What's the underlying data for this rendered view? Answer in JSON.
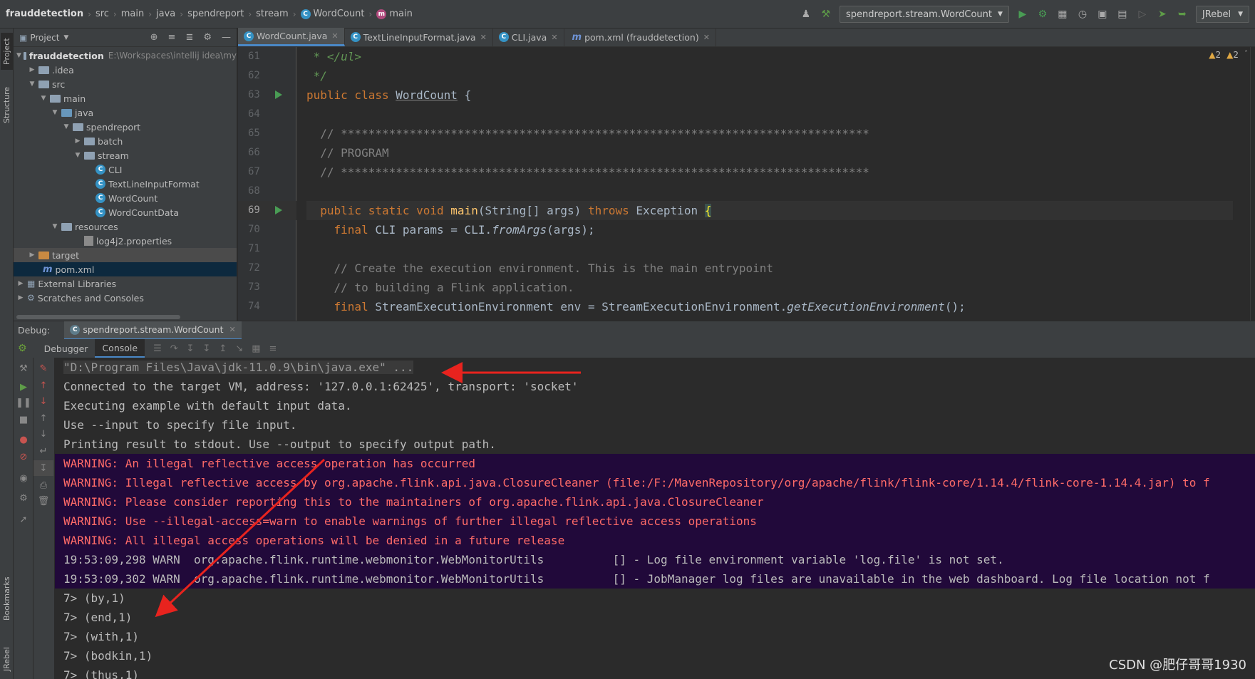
{
  "breadcrumbs": [
    "frauddetection",
    "src",
    "main",
    "java",
    "spendreport",
    "stream",
    "WordCount",
    "main"
  ],
  "toolbar": {
    "run_config": "spendreport.stream.WordCount",
    "jrebel": "JRebel"
  },
  "left_stripe": {
    "project": "Project",
    "structure": "Structure",
    "bookmarks": "Bookmarks",
    "jrebel": "JRebel"
  },
  "project_panel": {
    "title": "Project",
    "root_name": "frauddetection",
    "root_path": "E:\\Workspaces\\intellij idea\\my",
    "items": [
      {
        "label": ".idea"
      },
      {
        "label": "src"
      },
      {
        "label": "main"
      },
      {
        "label": "java"
      },
      {
        "label": "spendreport"
      },
      {
        "label": "batch"
      },
      {
        "label": "stream"
      },
      {
        "label": "CLI"
      },
      {
        "label": "TextLineInputFormat"
      },
      {
        "label": "WordCount"
      },
      {
        "label": "WordCountData"
      },
      {
        "label": "resources"
      },
      {
        "label": "log4j2.properties"
      },
      {
        "label": "target"
      },
      {
        "label": "pom.xml"
      },
      {
        "label": "External Libraries"
      },
      {
        "label": "Scratches and Consoles"
      }
    ]
  },
  "editor_tabs": [
    {
      "label": "WordCount.java"
    },
    {
      "label": "TextLineInputFormat.java"
    },
    {
      "label": "CLI.java"
    },
    {
      "label": "pom.xml (frauddetection)"
    }
  ],
  "inspections": {
    "warn1": "2",
    "warn2": "2"
  },
  "line_numbers": [
    "61",
    "62",
    "63",
    "64",
    "65",
    "66",
    "67",
    "68",
    "69",
    "70",
    "71",
    "72",
    "73",
    "74"
  ],
  "code": {
    "l61": " * </ul>",
    "l62": " */",
    "l63_kw": "public class ",
    "l63_name": "WordCount",
    "l63_rest": " {",
    "l65": "  // *****************************************************************************",
    "l66": "  // PROGRAM",
    "l67": "  // *****************************************************************************",
    "l69_kw": "  public static void ",
    "l69_fn": "main",
    "l69_args": "(String[] args) ",
    "l69_throws": "throws",
    "l69_exc": " Exception ",
    "l69_brace": "{",
    "l70_kw": "    final ",
    "l70_rest": "CLI params = CLI.",
    "l70_it": "fromArgs",
    "l70_end": "(args);",
    "l72": "    // Create the execution environment. This is the main entrypoint",
    "l73": "    // to building a Flink application.",
    "l74_kw": "    final ",
    "l74_rest": "StreamExecutionEnvironment env = StreamExecutionEnvironment.",
    "l74_it": "getExecutionEnvironment",
    "l74_end": "();"
  },
  "debug": {
    "label": "Debug:",
    "session": "spendreport.stream.WordCount",
    "debugger_tab": "Debugger",
    "console_tab": "Console"
  },
  "console": {
    "cmd": "\"D:\\Program Files\\Java\\jdk-11.0.9\\bin\\java.exe\" ...",
    "lines": [
      "Connected to the target VM, address: '127.0.0.1:62425', transport: 'socket'",
      "Executing example with default input data.",
      "Use --input to specify file input.",
      "Printing result to stdout. Use --output to specify output path."
    ],
    "warnings": [
      "WARNING: An illegal reflective access operation has occurred",
      "WARNING: Illegal reflective access by org.apache.flink.api.java.ClosureCleaner (file:/F:/MavenRepository/org/apache/flink/flink-core/1.14.4/flink-core-1.14.4.jar) to f",
      "WARNING: Please consider reporting this to the maintainers of org.apache.flink.api.java.ClosureCleaner",
      "WARNING: Use --illegal-access=warn to enable warnings of further illegal reflective access operations",
      "WARNING: All illegal access operations will be denied in a future release"
    ],
    "logs": [
      "19:53:09,298 WARN  org.apache.flink.runtime.webmonitor.WebMonitorUtils          [] - Log file environment variable 'log.file' is not set.",
      "19:53:09,302 WARN  org.apache.flink.runtime.webmonitor.WebMonitorUtils          [] - JobManager log files are unavailable in the web dashboard. Log file location not f"
    ],
    "results": [
      "7> (by,1)",
      "7> (end,1)",
      "7> (with,1)",
      "7> (bodkin,1)",
      "7> (thus,1)"
    ]
  },
  "watermark": "CSDN @肥仔哥哥1930",
  "colors": {
    "accent": "#4a88c7",
    "warning_bg": "#21093a",
    "warning_text": "#ff6b68",
    "annotation_arrow": "#e8231e"
  }
}
